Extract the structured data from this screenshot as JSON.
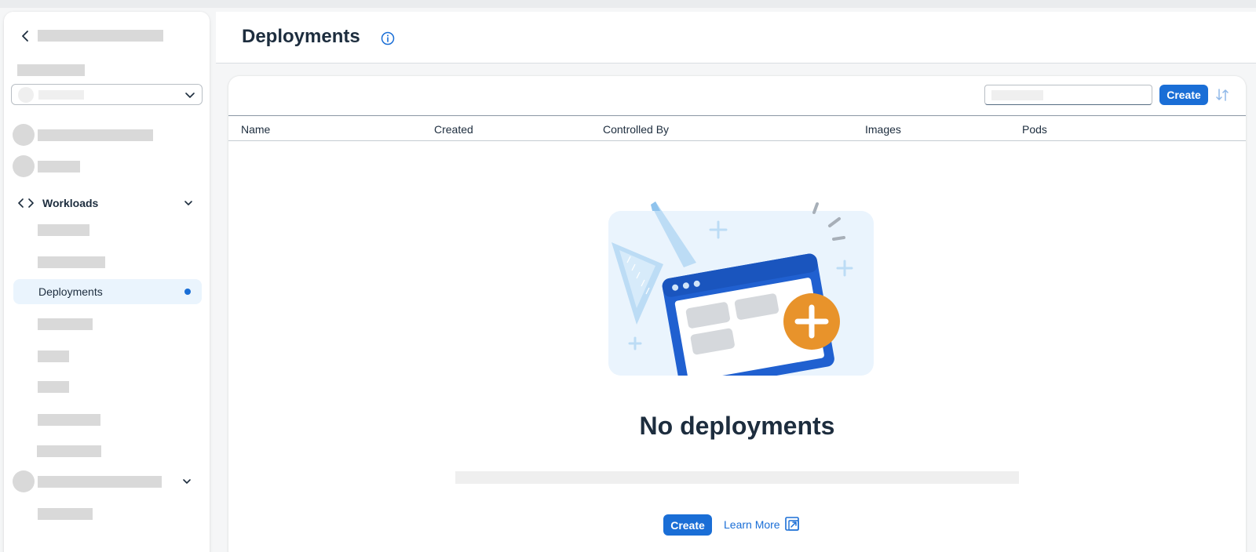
{
  "sidebar": {
    "group": {
      "label": "Workloads"
    },
    "selected_item": {
      "label": "Deployments"
    },
    "icons": {
      "back": "chevron-left-icon",
      "group": "code-icon",
      "expand": "chevron-down-icon"
    }
  },
  "header": {
    "title": "Deployments",
    "info_icon": "info-icon"
  },
  "toolbar": {
    "search_value": "",
    "create_label": "Create",
    "sort_icon": "sort-icon"
  },
  "table": {
    "columns": [
      "Name",
      "Created",
      "Controlled By",
      "Images",
      "Pods"
    ]
  },
  "empty_state": {
    "title": "No deployments",
    "create_label": "Create",
    "learn_more_label": "Learn More"
  },
  "colors": {
    "accent": "#1a6ed6",
    "selected_bg": "#eaf4fd",
    "add_badge": "#e8932b",
    "text": "#1d2d3e"
  }
}
